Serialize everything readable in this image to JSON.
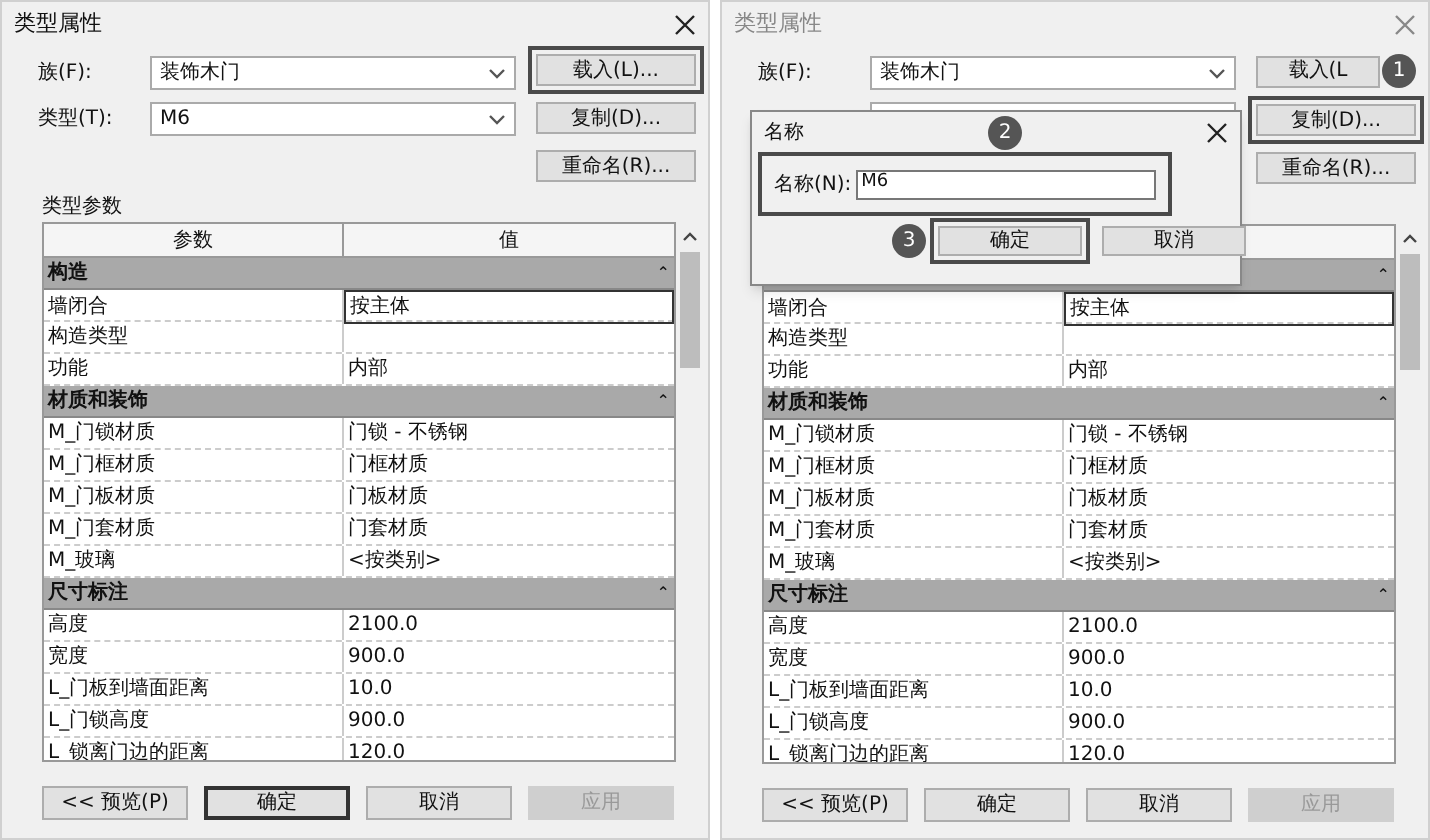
{
  "dialogs": [
    {
      "title": "类型属性",
      "active": true,
      "family_label": "族(F):",
      "family_value": "装饰木门",
      "type_label": "类型(T):",
      "type_value": "M6",
      "buttons": [
        {
          "label": "载入(L)...",
          "highlighted": true
        },
        {
          "label": "复制(D)...",
          "highlighted": false
        },
        {
          "label": "重命名(R)..."
        }
      ],
      "section_label": "类型参数",
      "columns": [
        "参数",
        "值"
      ],
      "rows": [
        {
          "kind": "group",
          "label": "构造",
          "collapse": "⌃"
        },
        {
          "kind": "param",
          "name": "墙闭合",
          "value": "按主体",
          "selected": true
        },
        {
          "kind": "param",
          "name": "构造类型",
          "selected": false
        },
        {
          "kind": "param",
          "name": "功能",
          "value": "内部",
          "selected": false
        },
        {
          "kind": "group",
          "label": "材质和装饰",
          "collapse": "⌃"
        },
        {
          "kind": "param",
          "name": "M_门锁材质",
          "value": "门锁 - 不锈钢",
          "selected": false
        },
        {
          "kind": "param",
          "name": "M_门框材质",
          "value": "门框材质",
          "selected": false
        },
        {
          "kind": "param",
          "name": "M_门板材质",
          "value": "门板材质",
          "selected": false
        },
        {
          "kind": "param",
          "name": "M_门套材质",
          "value": "门套材质",
          "selected": false
        },
        {
          "kind": "param",
          "name": "M_玻璃",
          "value": "<按类别>",
          "selected": false
        },
        {
          "kind": "group",
          "label": "尺寸标注",
          "collapse": "⌃"
        },
        {
          "kind": "param",
          "name": "高度",
          "value": "2100.0",
          "selected": false
        },
        {
          "kind": "param",
          "name": "宽度",
          "value": "900.0",
          "selected": false
        },
        {
          "kind": "param",
          "name": "L_门板到墙面距离",
          "value": "10.0",
          "selected": false
        },
        {
          "kind": "param",
          "name": "L_门锁高度",
          "value": "900.0",
          "selected": false
        },
        {
          "kind": "param",
          "name": "L_锁离门边的距离",
          "value": "120.0",
          "selected": false
        }
      ],
      "footer": [
        {
          "label": "<< 预览(P)",
          "default": false,
          "disabled": false
        },
        {
          "label": "确定",
          "default": true,
          "disabled": false
        },
        {
          "label": "取消",
          "default": false,
          "disabled": false
        },
        {
          "label": "应用",
          "default": false,
          "disabled": true
        }
      ]
    },
    {
      "title": "类型属性",
      "active": false,
      "family_label": "族(F):",
      "family_value": "装饰木门",
      "buttons": [
        {
          "label": "载入(L",
          "highlighted": false,
          "marker": "1"
        },
        {
          "label": "复制(D)...",
          "highlighted": true
        },
        {
          "label": "重命名(R)..."
        }
      ],
      "rows": [
        {
          "kind": "group",
          "collapse": "⌃"
        },
        {
          "kind": "param",
          "name": "墙闭合",
          "value": "按主体",
          "selected": true
        },
        {
          "kind": "param",
          "name": "构造类型",
          "selected": false
        },
        {
          "kind": "param",
          "name": "功能",
          "value": "内部",
          "selected": false
        },
        {
          "kind": "group",
          "label": "材质和装饰",
          "collapse": "⌃"
        },
        {
          "kind": "param",
          "name": "M_门锁材质",
          "value": "门锁 - 不锈钢",
          "selected": false
        },
        {
          "kind": "param",
          "name": "M_门框材质",
          "value": "门框材质",
          "selected": false
        },
        {
          "kind": "param",
          "name": "M_门板材质",
          "value": "门板材质",
          "selected": false
        },
        {
          "kind": "param",
          "name": "M_门套材质",
          "value": "门套材质",
          "selected": false
        },
        {
          "kind": "param",
          "name": "M_玻璃",
          "value": "<按类别>",
          "selected": false
        },
        {
          "kind": "group",
          "label": "尺寸标注",
          "collapse": "⌃"
        },
        {
          "kind": "param",
          "name": "高度",
          "value": "2100.0",
          "selected": false
        },
        {
          "kind": "param",
          "name": "宽度",
          "value": "900.0",
          "selected": false
        },
        {
          "kind": "param",
          "name": "L_门板到墙面距离",
          "value": "10.0",
          "selected": false
        },
        {
          "kind": "param",
          "name": "L_门锁高度",
          "value": "900.0",
          "selected": false
        },
        {
          "kind": "param",
          "name": "L_锁离门边的距离",
          "value": "120.0",
          "selected": false
        }
      ],
      "footer": [
        {
          "label": "<< 预览(P)",
          "default": false,
          "disabled": false
        },
        {
          "label": "确定",
          "default": false,
          "disabled": false
        },
        {
          "label": "取消",
          "default": false,
          "disabled": false
        },
        {
          "label": "应用",
          "default": false,
          "disabled": true
        }
      ],
      "name_dialog": {
        "title": "名称",
        "title_marker": "2",
        "field_label": "名称(N):",
        "field_value": "M6",
        "field_highlighted": true,
        "buttons": [
          {
            "label": "确定",
            "highlighted": true,
            "marker": "3"
          },
          {
            "label": "取消",
            "highlighted": false
          }
        ]
      }
    }
  ]
}
